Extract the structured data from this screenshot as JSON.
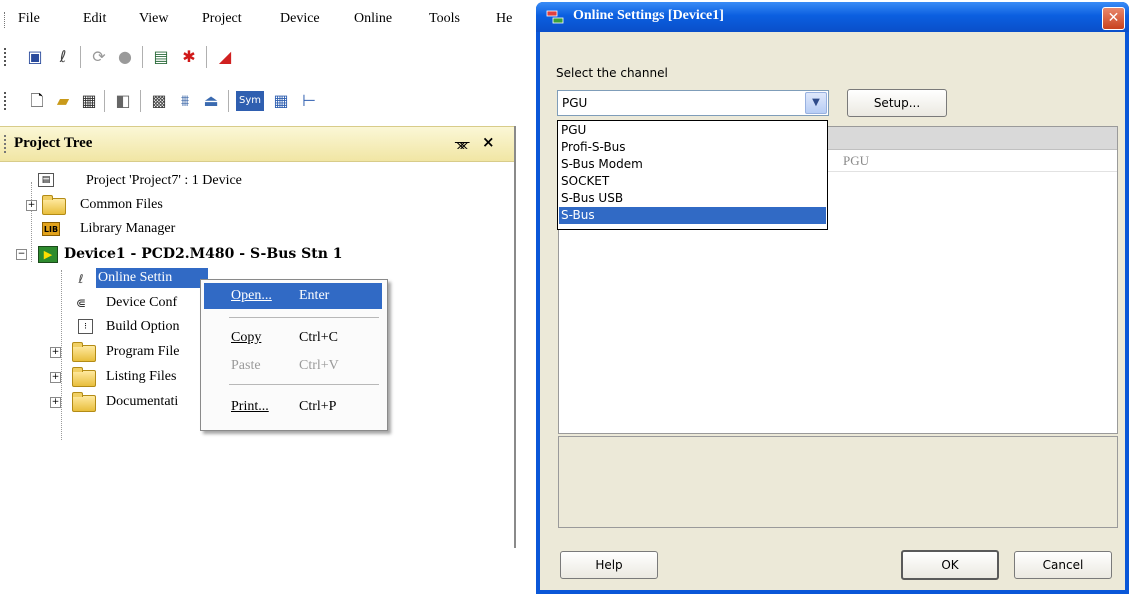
{
  "menubar": {
    "items": [
      "File",
      "Edit",
      "View",
      "Project",
      "Device",
      "Online",
      "Tools",
      "He"
    ]
  },
  "toolbar1": {
    "icons": [
      "online-settings-icon",
      "connect-icon",
      "refresh-icon",
      "stop-icon",
      "monitor-icon",
      "debug-bug-icon",
      "diagnostics-icon"
    ]
  },
  "toolbar2": {
    "icons": [
      "new-icon",
      "open-icon",
      "save-all-icon",
      "properties-icon",
      "build-icon",
      "rebuild-icon",
      "download-icon"
    ],
    "sym_label": "Sym"
  },
  "project_tree": {
    "title": "Project Tree",
    "pin_glyph": "Ṟ",
    "close_glyph": "×",
    "items": {
      "project": "Project 'Project7' : 1 Device",
      "common_files": "Common Files",
      "library_manager": "Library Manager",
      "device": "Device1 - PCD2.M480 - S-Bus Stn 1",
      "online_settings": "Online Settin",
      "device_config": "Device Conf",
      "build_options": "Build Option",
      "program_files": "Program File",
      "listing_files": "Listing Files",
      "documentation": "Documentati"
    },
    "lib_badge": "LIB"
  },
  "context_menu": {
    "open_label": "Open...",
    "open_key": "Enter",
    "copy_label": "Copy",
    "copy_key": "Ctrl+C",
    "paste_label": "Paste",
    "paste_key": "Ctrl+V",
    "print_label": "Print...",
    "print_key": "Ctrl+P"
  },
  "dialog": {
    "title": "Online Settings [Device1]",
    "close_glyph": "✕",
    "select_label": "Select the channel",
    "channel_value": "PGU",
    "setup_label": "Setup...",
    "dropdown_options": [
      "PGU",
      "Profi-S-Bus",
      "S-Bus Modem",
      "SOCKET",
      "S-Bus USB",
      "S-Bus"
    ],
    "selected_option": "S-Bus",
    "grid_value": "PGU",
    "help_label": "Help",
    "ok_label": "OK",
    "cancel_label": "Cancel"
  },
  "colors": {
    "selection": "#316ac5",
    "title_blue": "#0b5fe0",
    "panel_header": "#f1e6a4",
    "dialog_bg": "#ece9d8"
  }
}
